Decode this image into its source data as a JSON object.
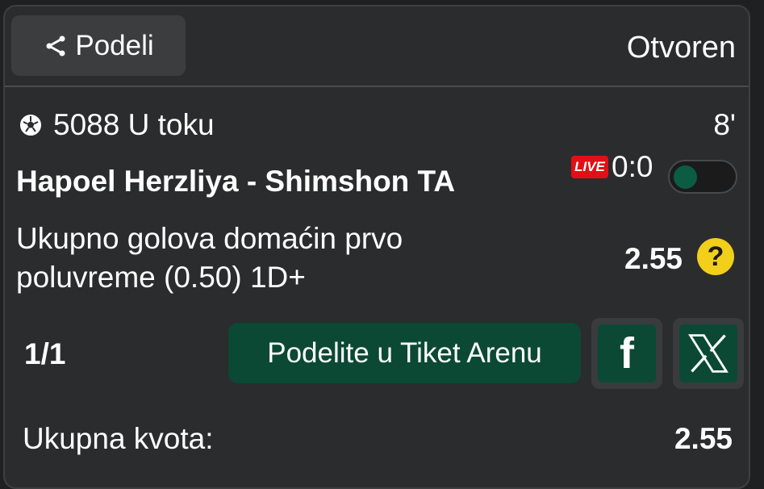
{
  "header": {
    "share_label": "Podeli",
    "status": "Otvoren"
  },
  "match": {
    "code_status": "5088 U toku",
    "minute": "8'",
    "teams": "Hapoel Herzliya - Shimshon TA",
    "live_badge": "LIVE",
    "score": "0:0"
  },
  "bet": {
    "market": "Ukupno golova domaćin prvo poluvreme (0.50) 1D+",
    "odd": "2.55",
    "help_symbol": "?"
  },
  "actions": {
    "count": "1/1",
    "arena_button": "Podelite u Tiket Arenu",
    "facebook_letter": "f"
  },
  "summary": {
    "total_label": "Ukupna kvota:",
    "total_value": "2.55"
  },
  "icons": {
    "share": "share-icon",
    "ball": "soccer-ball-icon",
    "facebook": "facebook-icon",
    "x": "x-icon"
  },
  "colors": {
    "accent_green": "#0b4934",
    "live_red": "#e30f16",
    "help_yellow": "#f2cf1b"
  }
}
